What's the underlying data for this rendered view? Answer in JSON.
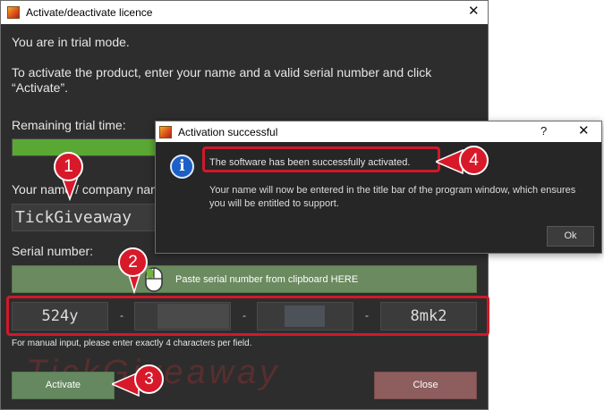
{
  "main_window": {
    "title": "Activate/deactivate licence",
    "trial_mode_text": "You are in trial mode.",
    "instruction_line1": "To activate the product, enter your name and a valid serial number and click",
    "instruction_line2": "“Activate”.",
    "remaining_trial_label": "Remaining trial time:",
    "trial_progress": 0.34,
    "name_label": "Your name / company name",
    "name_value": "TickGiveaway",
    "serial_label": "Serial number:",
    "paste_button": "Paste serial number from clipboard HERE",
    "serial_fields": [
      "524y",
      "",
      "",
      "8mk2"
    ],
    "serial_separator": "-",
    "manual_input_hint": "For manual input, please enter exactly 4 characters per field.",
    "activate_button": "Activate",
    "close_button": "Close",
    "watermark": "TickGiveaway"
  },
  "dialog": {
    "title": "Activation successful",
    "help": "?",
    "message": "The software has been successfully activated.",
    "submessage": "Your name will now be entered in the title bar of the program window, which ensures you will be entitled to support.",
    "ok_button": "Ok",
    "info_icon": "i"
  },
  "callouts": [
    "1",
    "2",
    "3",
    "4"
  ],
  "colors": {
    "annotation_red": "#d8192a",
    "progress_green": "#5aa834",
    "activate_green": "#668860",
    "close_red": "#8e5e5e",
    "info_blue": "#1c5fc6"
  },
  "icons": {
    "app": "app-icon",
    "close": "close-icon",
    "mouse": "mouse-icon",
    "info": "info-icon",
    "help": "help-icon"
  }
}
